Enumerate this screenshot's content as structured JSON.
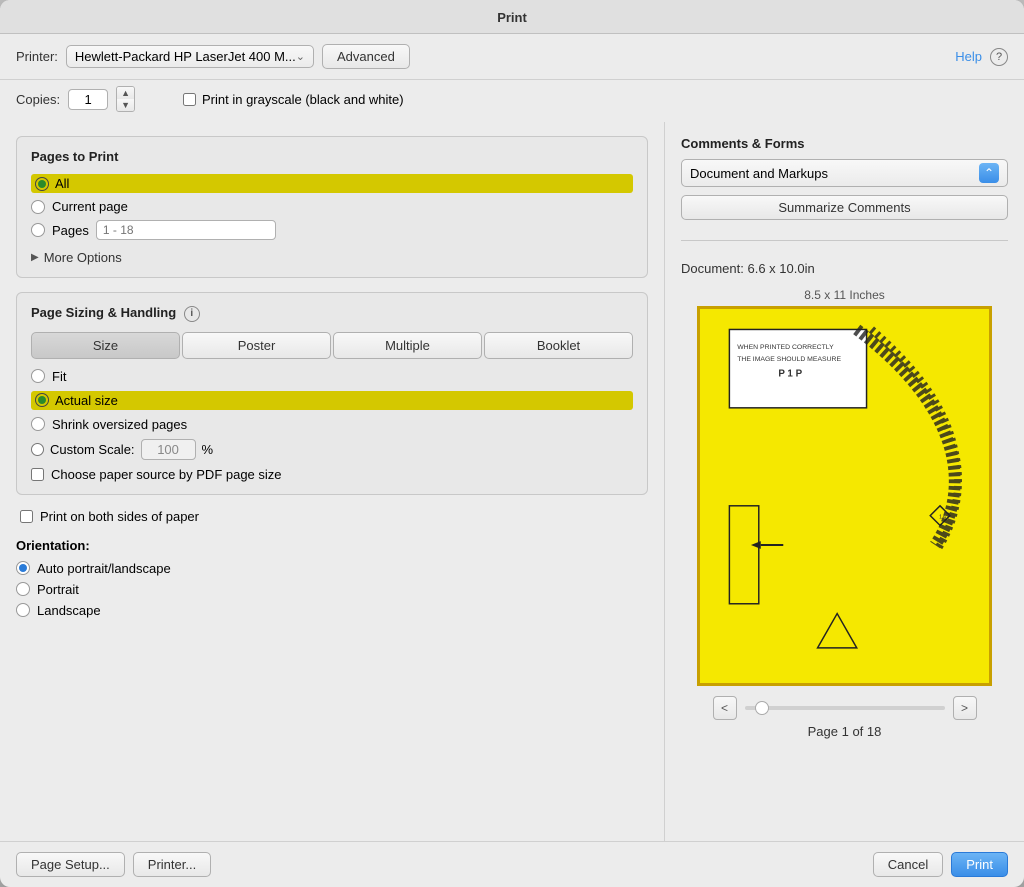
{
  "dialog": {
    "title": "Print"
  },
  "header": {
    "printer_label": "Printer:",
    "printer_value": "Hewlett-Packard HP LaserJet 400 M...",
    "advanced_button": "Advanced",
    "help_link": "Help",
    "copies_label": "Copies:",
    "copies_value": "1",
    "grayscale_label": "Print in grayscale (black and white)"
  },
  "pages_section": {
    "title": "Pages to Print",
    "all_label": "All",
    "current_page_label": "Current page",
    "pages_label": "Pages",
    "pages_placeholder": "1 - 18",
    "more_options_label": "More Options"
  },
  "sizing_section": {
    "title": "Page Sizing & Handling",
    "tabs": [
      "Size",
      "Poster",
      "Multiple",
      "Booklet"
    ],
    "active_tab": "Size",
    "fit_label": "Fit",
    "actual_size_label": "Actual size",
    "shrink_label": "Shrink oversized pages",
    "custom_scale_label": "Custom Scale:",
    "custom_scale_value": "100",
    "custom_scale_unit": "%",
    "pdf_source_label": "Choose paper source by PDF page size"
  },
  "orientation_section": {
    "label": "Orientation:",
    "options": [
      "Auto portrait/landscape",
      "Portrait",
      "Landscape"
    ],
    "selected": "Auto portrait/landscape"
  },
  "duplex_section": {
    "label": "Print on both sides of paper"
  },
  "comments_forms": {
    "title": "Comments & Forms",
    "dropdown_value": "Document and Markups",
    "summarize_button": "Summarize Comments",
    "doc_info": "Document: 6.6 x 10.0in",
    "preview_size_label": "8.5 x 11 Inches",
    "page_info": "Page 1 of 18"
  },
  "bottom": {
    "page_setup": "Page Setup...",
    "printer_btn": "Printer...",
    "cancel_btn": "Cancel",
    "print_btn": "Print"
  }
}
